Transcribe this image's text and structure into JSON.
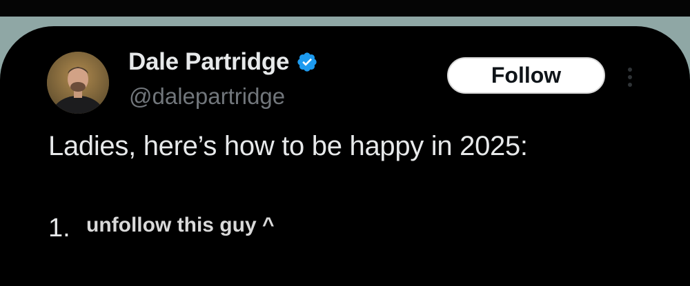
{
  "post": {
    "author": {
      "display_name": "Dale Partridge",
      "handle": "@dalepartridge",
      "verified": true,
      "avatar": "profile-photo"
    },
    "follow_label": "Follow",
    "menu_icon": "more-vertical-icon",
    "text": "Ladies, here’s how to be happy in 2025:",
    "list_number": "1."
  },
  "overlay": {
    "caption": "unfollow this guy ^"
  },
  "colors": {
    "background": "#000000",
    "page_border": "#8fa7a5",
    "verified": "#1d9bf0",
    "primary_text": "#e7e9ea",
    "secondary_text": "#71767b",
    "follow_bg": "#ffffff"
  }
}
